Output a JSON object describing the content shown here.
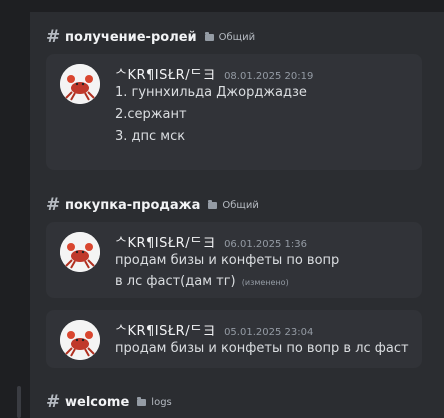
{
  "sections": [
    {
      "channel": "получение-ролей",
      "category": "Общий",
      "messages": [
        {
          "author": "ᄉKR¶ISŁR/ᄃヨ",
          "time": "08.01.2025 20:19",
          "lines": [
            "1. гуннхильда Джорджадзе",
            "2.сержант",
            "3. дпс мск"
          ]
        }
      ]
    },
    {
      "channel": "покупка-продажа",
      "category": "Общий",
      "messages": [
        {
          "author": "ᄉKR¶ISŁR/ᄃヨ",
          "time": "06.01.2025 1:36",
          "text": "продам бизы и конфеты по вопр в лс фаст(дам тг)",
          "edited": "(изменено)"
        },
        {
          "author": "ᄉKR¶ISŁR/ᄃヨ",
          "time": "05.01.2025 23:04",
          "text": "продам бизы и конфеты по вопр в лс фаст"
        }
      ]
    },
    {
      "channel": "welcome",
      "category": "logs"
    }
  ]
}
